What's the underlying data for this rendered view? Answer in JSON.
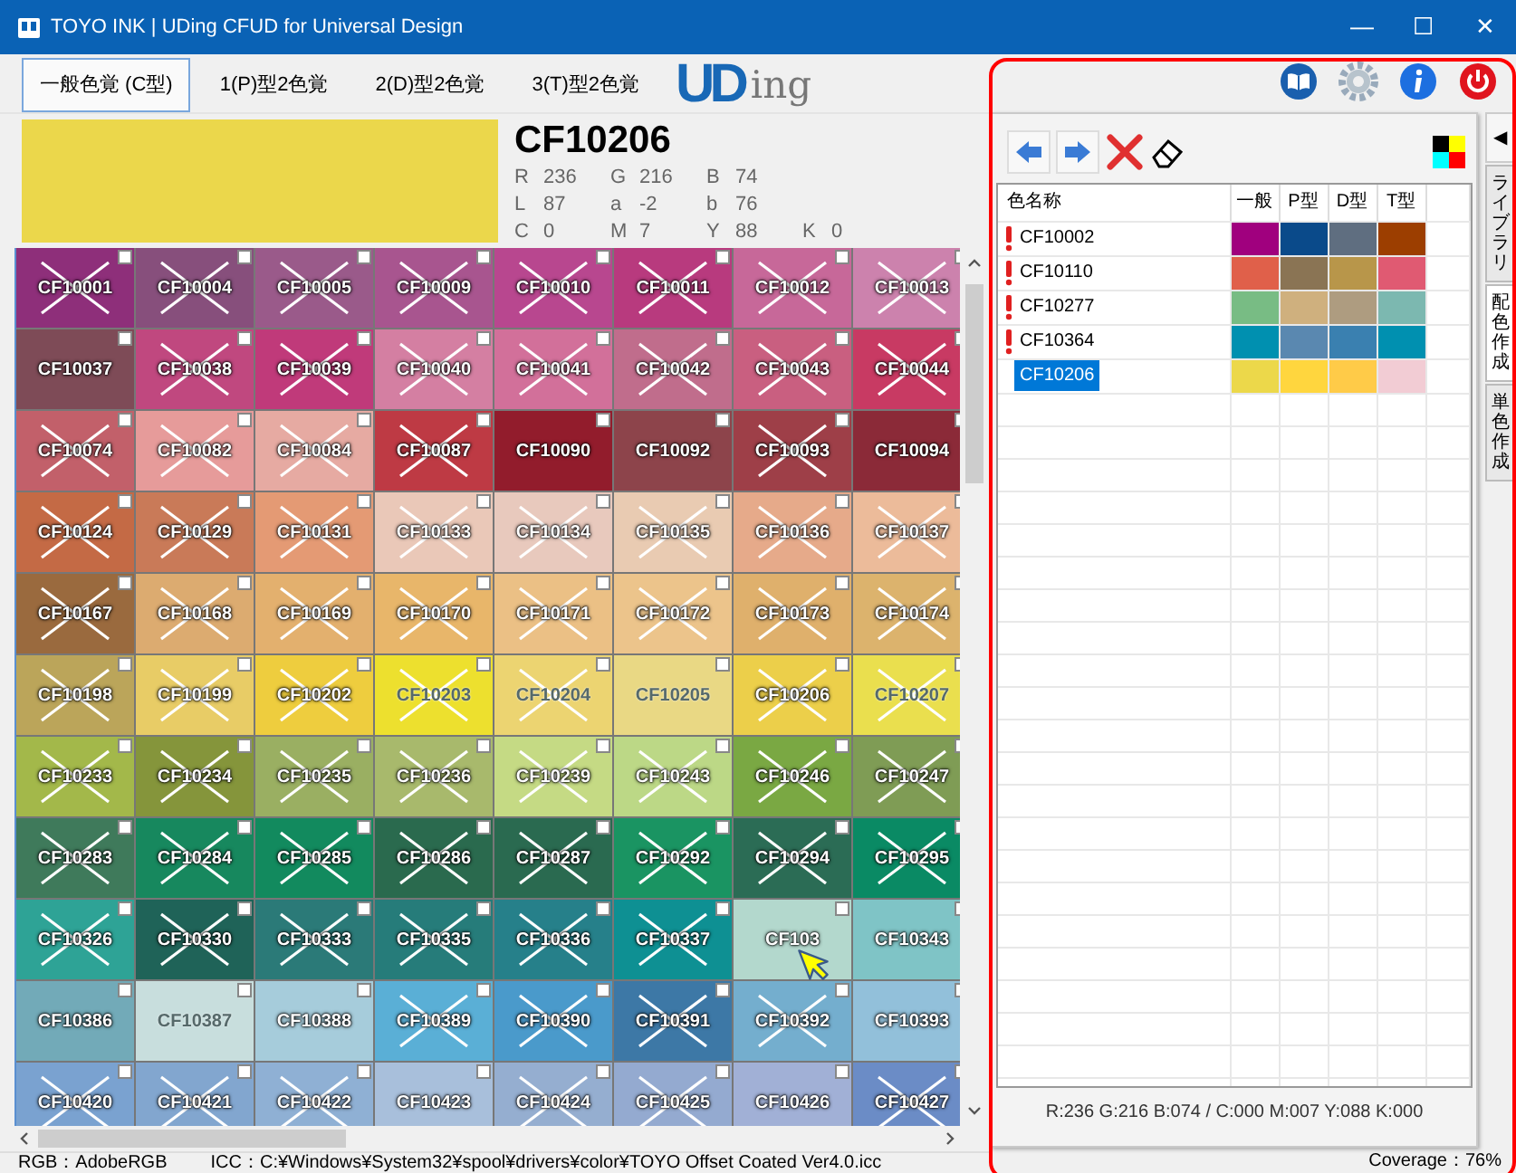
{
  "window": {
    "title": "TOYO INK | UDing CFUD for Universal Design",
    "controls": [
      "—",
      "☐",
      "✕"
    ]
  },
  "tabs": [
    {
      "label": "一般色覚 (C型)",
      "selected": true
    },
    {
      "label": "1(P)型2色覚",
      "selected": false
    },
    {
      "label": "2(D)型2色覚",
      "selected": false
    },
    {
      "label": "3(T)型2色覚",
      "selected": false
    }
  ],
  "logo": {
    "mark": "UD",
    "text": "ing"
  },
  "current": {
    "name": "CF10206",
    "color": "#ebd74b",
    "stats": [
      [
        {
          "label": "R",
          "value": "236"
        },
        {
          "label": "G",
          "value": "216"
        },
        {
          "label": "B",
          "value": "74"
        }
      ],
      [
        {
          "label": "L",
          "value": "87"
        },
        {
          "label": "a",
          "value": "-2"
        },
        {
          "label": "b",
          "value": "76"
        }
      ],
      [
        {
          "label": "C",
          "value": "0"
        },
        {
          "label": "M",
          "value": "7"
        },
        {
          "label": "Y",
          "value": "88"
        },
        {
          "label": "K",
          "value": "0"
        }
      ]
    ]
  },
  "grid": {
    "rows": [
      {
        "cells": [
          {
            "label": "CF10001",
            "color": "#8e2f7a",
            "crossed": true
          },
          {
            "label": "CF10004",
            "color": "#874f7c",
            "crossed": true
          },
          {
            "label": "CF10005",
            "color": "#9a5a8a",
            "crossed": true
          },
          {
            "label": "CF10009",
            "color": "#a8558f",
            "crossed": true
          },
          {
            "label": "CF10010",
            "color": "#b8478f",
            "crossed": true
          },
          {
            "label": "CF10011",
            "color": "#b83a7e",
            "crossed": true
          },
          {
            "label": "CF10012",
            "color": "#c76899",
            "crossed": true
          },
          {
            "label": "CF10013",
            "color": "#cc82ad",
            "crossed": true
          }
        ]
      },
      {
        "cells": [
          {
            "label": "CF10037",
            "color": "#7e4b57",
            "crossed": false
          },
          {
            "label": "CF10038",
            "color": "#c0487f",
            "crossed": true
          },
          {
            "label": "CF10039",
            "color": "#c03a7a",
            "crossed": true
          },
          {
            "label": "CF10040",
            "color": "#d47fa2",
            "crossed": true
          },
          {
            "label": "CF10041",
            "color": "#d2709a",
            "crossed": true
          },
          {
            "label": "CF10042",
            "color": "#c06d8c",
            "crossed": true
          },
          {
            "label": "CF10043",
            "color": "#c95f80",
            "crossed": true
          },
          {
            "label": "CF10044",
            "color": "#c83a63",
            "crossed": true
          }
        ]
      },
      {
        "cells": [
          {
            "label": "CF10074",
            "color": "#c2606a",
            "crossed": true
          },
          {
            "label": "CF10082",
            "color": "#e69b9a",
            "crossed": true
          },
          {
            "label": "CF10084",
            "color": "#e6aaa2",
            "crossed": true
          },
          {
            "label": "CF10087",
            "color": "#be3a44",
            "crossed": true
          },
          {
            "label": "CF10090",
            "color": "#921c2c",
            "crossed": false
          },
          {
            "label": "CF10092",
            "color": "#8d444b",
            "crossed": false
          },
          {
            "label": "CF10093",
            "color": "#9e3f48",
            "crossed": true
          },
          {
            "label": "CF10094",
            "color": "#8b2a38",
            "crossed": false
          }
        ]
      },
      {
        "cells": [
          {
            "label": "CF10124",
            "color": "#c46a45",
            "crossed": true
          },
          {
            "label": "CF10129",
            "color": "#c97a58",
            "crossed": true
          },
          {
            "label": "CF10131",
            "color": "#e49a74",
            "crossed": true
          },
          {
            "label": "CF10133",
            "color": "#eac8b8",
            "crossed": true
          },
          {
            "label": "CF10134",
            "color": "#e8c9bd",
            "crossed": true
          },
          {
            "label": "CF10135",
            "color": "#e9cbb2",
            "crossed": true
          },
          {
            "label": "CF10136",
            "color": "#e6aa8a",
            "crossed": true
          },
          {
            "label": "CF10137",
            "color": "#ecbb9a",
            "crossed": true
          }
        ]
      },
      {
        "cells": [
          {
            "label": "CF10167",
            "color": "#9a6a3e",
            "crossed": true
          },
          {
            "label": "CF10168",
            "color": "#dcab70",
            "crossed": true
          },
          {
            "label": "CF10169",
            "color": "#e3b06e",
            "crossed": true
          },
          {
            "label": "CF10170",
            "color": "#e8b66a",
            "crossed": true
          },
          {
            "label": "CF10171",
            "color": "#ebc085",
            "crossed": true
          },
          {
            "label": "CF10172",
            "color": "#ecc48b",
            "crossed": true
          },
          {
            "label": "CF10173",
            "color": "#dfb06c",
            "crossed": true
          },
          {
            "label": "CF10174",
            "color": "#dcb36d",
            "crossed": true
          }
        ]
      },
      {
        "cells": [
          {
            "label": "CF10198",
            "color": "#bba55a",
            "crossed": true
          },
          {
            "label": "CF10199",
            "color": "#e8cc66",
            "crossed": true
          },
          {
            "label": "CF10202",
            "color": "#eecd3e",
            "crossed": true
          },
          {
            "label": "CF10203",
            "color": "#ede02e",
            "crossed": true
          },
          {
            "label": "CF10204",
            "color": "#ecd471",
            "crossed": true
          },
          {
            "label": "CF10205",
            "color": "#e9d884",
            "crossed": false
          },
          {
            "label": "CF10206",
            "color": "#eccf4a",
            "crossed": true
          },
          {
            "label": "CF10207",
            "color": "#eadf4e",
            "crossed": true
          }
        ]
      },
      {
        "cells": [
          {
            "label": "CF10233",
            "color": "#a3b84a",
            "crossed": true
          },
          {
            "label": "CF10234",
            "color": "#85953b",
            "crossed": true
          },
          {
            "label": "CF10235",
            "color": "#9aaf62",
            "crossed": true
          },
          {
            "label": "CF10236",
            "color": "#a8b96c",
            "crossed": true
          },
          {
            "label": "CF10239",
            "color": "#c5da84",
            "crossed": true
          },
          {
            "label": "CF10243",
            "color": "#bcd886",
            "crossed": true
          },
          {
            "label": "CF10246",
            "color": "#7aa843",
            "crossed": true
          },
          {
            "label": "CF10247",
            "color": "#7f9c55",
            "crossed": true
          }
        ]
      },
      {
        "cells": [
          {
            "label": "CF10283",
            "color": "#3f7a5b",
            "crossed": true
          },
          {
            "label": "CF10284",
            "color": "#17885e",
            "crossed": true
          },
          {
            "label": "CF10285",
            "color": "#128a5e",
            "crossed": true
          },
          {
            "label": "CF10286",
            "color": "#2a6a4e",
            "crossed": true
          },
          {
            "label": "CF10287",
            "color": "#2a6a50",
            "crossed": true
          },
          {
            "label": "CF10292",
            "color": "#1a9462",
            "crossed": true
          },
          {
            "label": "CF10294",
            "color": "#2b6c55",
            "crossed": true
          },
          {
            "label": "CF10295",
            "color": "#0a8a64",
            "crossed": true
          }
        ]
      },
      {
        "cells": [
          {
            "label": "CF10326",
            "color": "#2ea396",
            "crossed": true
          },
          {
            "label": "CF10330",
            "color": "#1f6358",
            "crossed": true
          },
          {
            "label": "CF10333",
            "color": "#2b7a78",
            "crossed": true
          },
          {
            "label": "CF10335",
            "color": "#267c7a",
            "crossed": true
          },
          {
            "label": "CF10336",
            "color": "#26808a",
            "crossed": true
          },
          {
            "label": "CF10337",
            "color": "#0e9093",
            "crossed": true
          },
          {
            "label": "CF103",
            "color": "#b3d8cd",
            "crossed": false
          },
          {
            "label": "CF10343",
            "color": "#7fc4c6",
            "crossed": false
          }
        ]
      },
      {
        "cells": [
          {
            "label": "CF10386",
            "color": "#72aab8",
            "crossed": false
          },
          {
            "label": "CF10387",
            "color": "#c8dedd",
            "crossed": false
          },
          {
            "label": "CF10388",
            "color": "#a6ccdb",
            "crossed": false
          },
          {
            "label": "CF10389",
            "color": "#5aafd6",
            "crossed": true
          },
          {
            "label": "CF10390",
            "color": "#4a9acb",
            "crossed": true
          },
          {
            "label": "CF10391",
            "color": "#3d78a6",
            "crossed": true
          },
          {
            "label": "CF10392",
            "color": "#74aece",
            "crossed": true
          },
          {
            "label": "CF10393",
            "color": "#92c0da",
            "crossed": false
          }
        ]
      },
      {
        "cells": [
          {
            "label": "CF10420",
            "color": "#7aa2d0",
            "crossed": true
          },
          {
            "label": "CF10421",
            "color": "#82a6cf",
            "crossed": true
          },
          {
            "label": "CF10422",
            "color": "#8fb0d4",
            "crossed": true
          },
          {
            "label": "CF10423",
            "color": "#a8bfdb",
            "crossed": false
          },
          {
            "label": "CF10424",
            "color": "#95aed0",
            "crossed": true
          },
          {
            "label": "CF10425",
            "color": "#94aad0",
            "crossed": true
          },
          {
            "label": "CF10426",
            "color": "#a1b0d6",
            "crossed": false
          },
          {
            "label": "CF10427",
            "color": "#6b8cc6",
            "crossed": true
          }
        ]
      }
    ]
  },
  "palette": {
    "columns": [
      "色名称",
      "一般",
      "P型",
      "D型",
      "T型"
    ],
    "rows": [
      {
        "name": "CF10002",
        "warning": true,
        "selected": false,
        "chips": [
          {
            "color": "#a0007e"
          },
          {
            "color": "#0a4a8a"
          },
          {
            "color": "#5f6e80"
          },
          {
            "color": "#9c3e00"
          }
        ]
      },
      {
        "name": "CF10110",
        "warning": true,
        "selected": false,
        "chips": [
          {
            "color": "#e0604a"
          },
          {
            "color": "#8a7454"
          },
          {
            "color": "#b8964a"
          },
          {
            "color": "#e05a72"
          }
        ]
      },
      {
        "name": "CF10277",
        "warning": true,
        "selected": false,
        "chips": [
          {
            "color": "#78bc84"
          },
          {
            "color": "#cfb07e"
          },
          {
            "color": "#ae9c80"
          },
          {
            "color": "#7cb8b0"
          }
        ]
      },
      {
        "name": "CF10364",
        "warning": true,
        "selected": false,
        "chips": [
          {
            "color": "#0090b0"
          },
          {
            "color": "#5a88b0"
          },
          {
            "color": "#3a80b0"
          },
          {
            "color": "#0090b0"
          }
        ]
      },
      {
        "name": "CF10206",
        "warning": false,
        "selected": true,
        "chips": [
          {
            "color": "#ecd84a"
          },
          {
            "color": "#ffd63e"
          },
          {
            "color": "#ffcb48"
          },
          {
            "color": "#f2ccd4"
          }
        ]
      }
    ],
    "readout": "R:236 G:216 B:074 / C:000 M:007 Y:088 K:000"
  },
  "side_tabs": {
    "collapse": "◀",
    "tabs": [
      {
        "label": "ライブラリ",
        "selected": false
      },
      {
        "label": "配色作成",
        "selected": true
      },
      {
        "label": "単色作成",
        "selected": false
      }
    ]
  },
  "status_bar": {
    "rgb": "RGB：AdobeRGB",
    "icc": "ICC：C:¥Windows¥System32¥spool¥drivers¥color¥TOYO Offset Coated Ver4.0.icc",
    "coverage": "Coverage：76%"
  }
}
